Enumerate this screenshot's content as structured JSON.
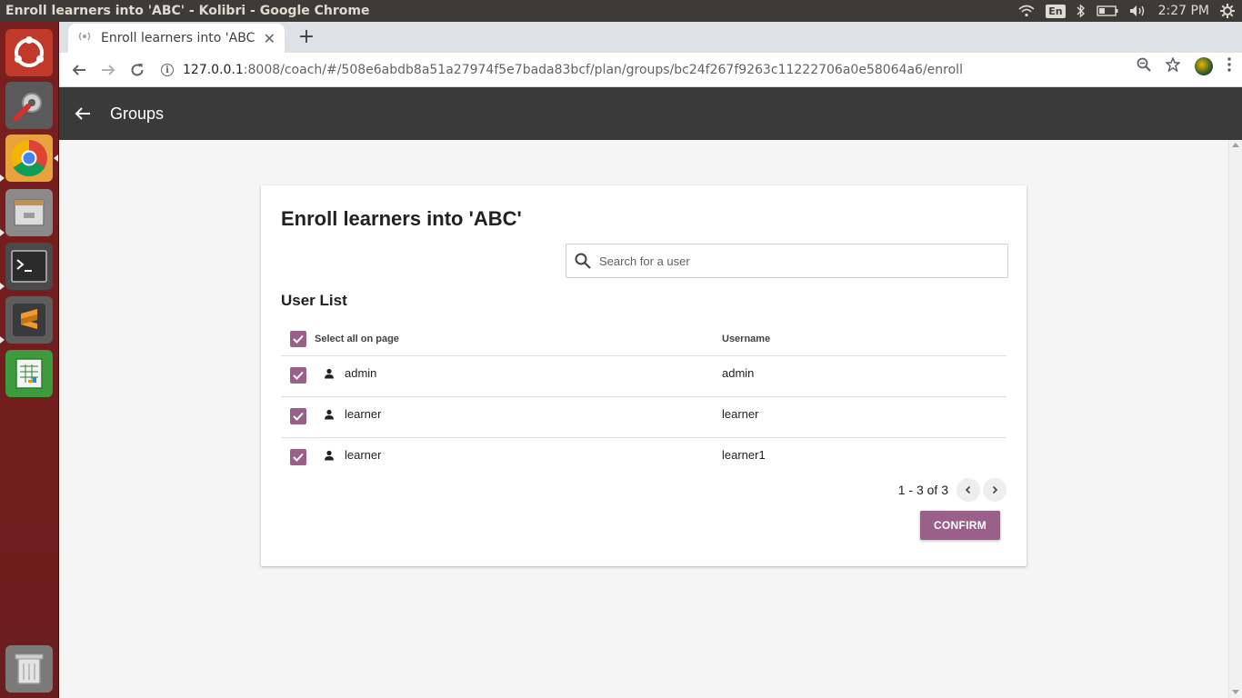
{
  "os": {
    "window_title": "Enroll learners into 'ABC' - Kolibri - Google Chrome",
    "lang": "En",
    "clock": "2:27 PM"
  },
  "browser": {
    "tab_title": "Enroll learners into 'ABC' - Kolibri",
    "url_host": "127.0.0.1",
    "url_rest": ":8008/coach/#/508e6abdb8a51a27974f5e7bada83bcf/plan/groups/bc24f267f9263c11222706a0e58064a6/enroll"
  },
  "header": {
    "title": "Groups"
  },
  "card": {
    "title": "Enroll learners into 'ABC'",
    "search_placeholder": "Search for a user",
    "section_title": "User List",
    "select_all_label": "Select all on page",
    "username_header": "Username",
    "rows": [
      {
        "name": "admin",
        "username": "admin"
      },
      {
        "name": "learner",
        "username": "learner"
      },
      {
        "name": "learner",
        "username": "learner1"
      }
    ],
    "pagination_text": "1 - 3 of 3",
    "confirm_label": "CONFIRM"
  },
  "colors": {
    "accent": "#996189",
    "header_bg": "#3a3a3a"
  }
}
